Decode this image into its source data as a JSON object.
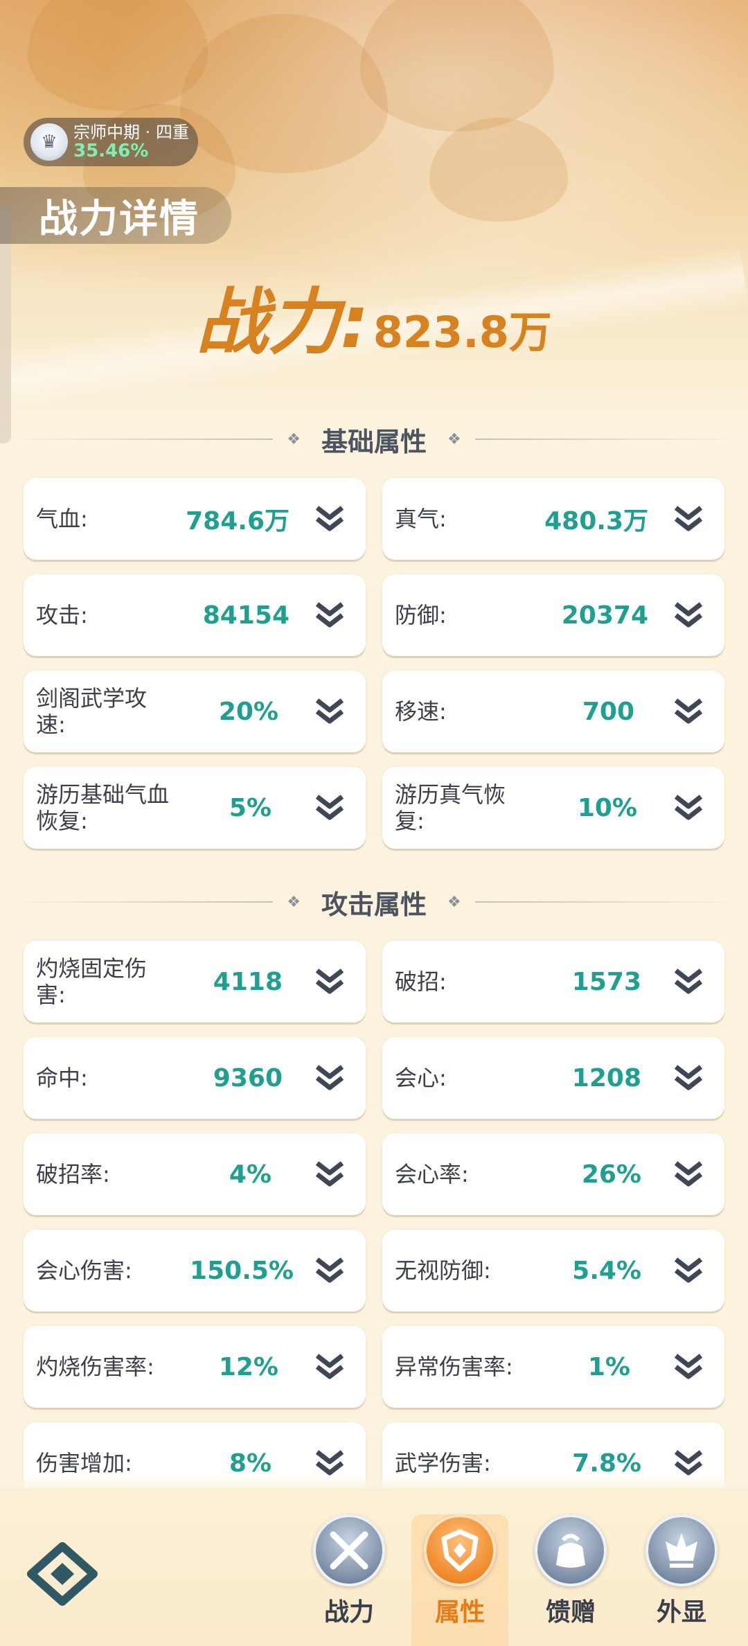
{
  "header": {
    "realm_name": "宗师中期 · 四重",
    "realm_progress": "35.46%",
    "page_title": "战力详情",
    "power_label": "战力:",
    "power_value": "823.8万"
  },
  "sections": [
    {
      "title": "基础属性",
      "items": [
        {
          "name": "气血:",
          "value": "784.6万"
        },
        {
          "name": "真气:",
          "value": "480.3万"
        },
        {
          "name": "攻击:",
          "value": "84154"
        },
        {
          "name": "防御:",
          "value": "20374"
        },
        {
          "name": "剑阁武学攻速:",
          "value": "20%"
        },
        {
          "name": "移速:",
          "value": "700"
        },
        {
          "name": "游历基础气血恢复:",
          "value": "5%"
        },
        {
          "name": "游历真气恢复:",
          "value": "10%"
        }
      ]
    },
    {
      "title": "攻击属性",
      "items": [
        {
          "name": "灼烧固定伤害:",
          "value": "4118"
        },
        {
          "name": "破招:",
          "value": "1573"
        },
        {
          "name": "命中:",
          "value": "9360"
        },
        {
          "name": "会心:",
          "value": "1208"
        },
        {
          "name": "破招率:",
          "value": "4%"
        },
        {
          "name": "会心率:",
          "value": "26%"
        },
        {
          "name": "会心伤害:",
          "value": "150.5%"
        },
        {
          "name": "无视防御:",
          "value": "5.4%"
        },
        {
          "name": "灼烧伤害率:",
          "value": "12%"
        },
        {
          "name": "异常伤害率:",
          "value": "1%"
        },
        {
          "name": "伤害增加:",
          "value": "8%"
        },
        {
          "name": "武学伤害:",
          "value": "7.8%"
        }
      ]
    }
  ],
  "tabs": [
    {
      "label": "战力",
      "icon": "swords-icon",
      "active": false
    },
    {
      "label": "属性",
      "icon": "shield-icon",
      "active": true
    },
    {
      "label": "馈赠",
      "icon": "gift-bag-icon",
      "active": false
    },
    {
      "label": "外显",
      "icon": "crown-wing-icon",
      "active": false
    }
  ],
  "colors": {
    "value_teal": "#1f9f8f",
    "power_orange": "#d8811f",
    "active_tab": "#e47c18",
    "realm_progress_green": "#7ef0b4"
  }
}
